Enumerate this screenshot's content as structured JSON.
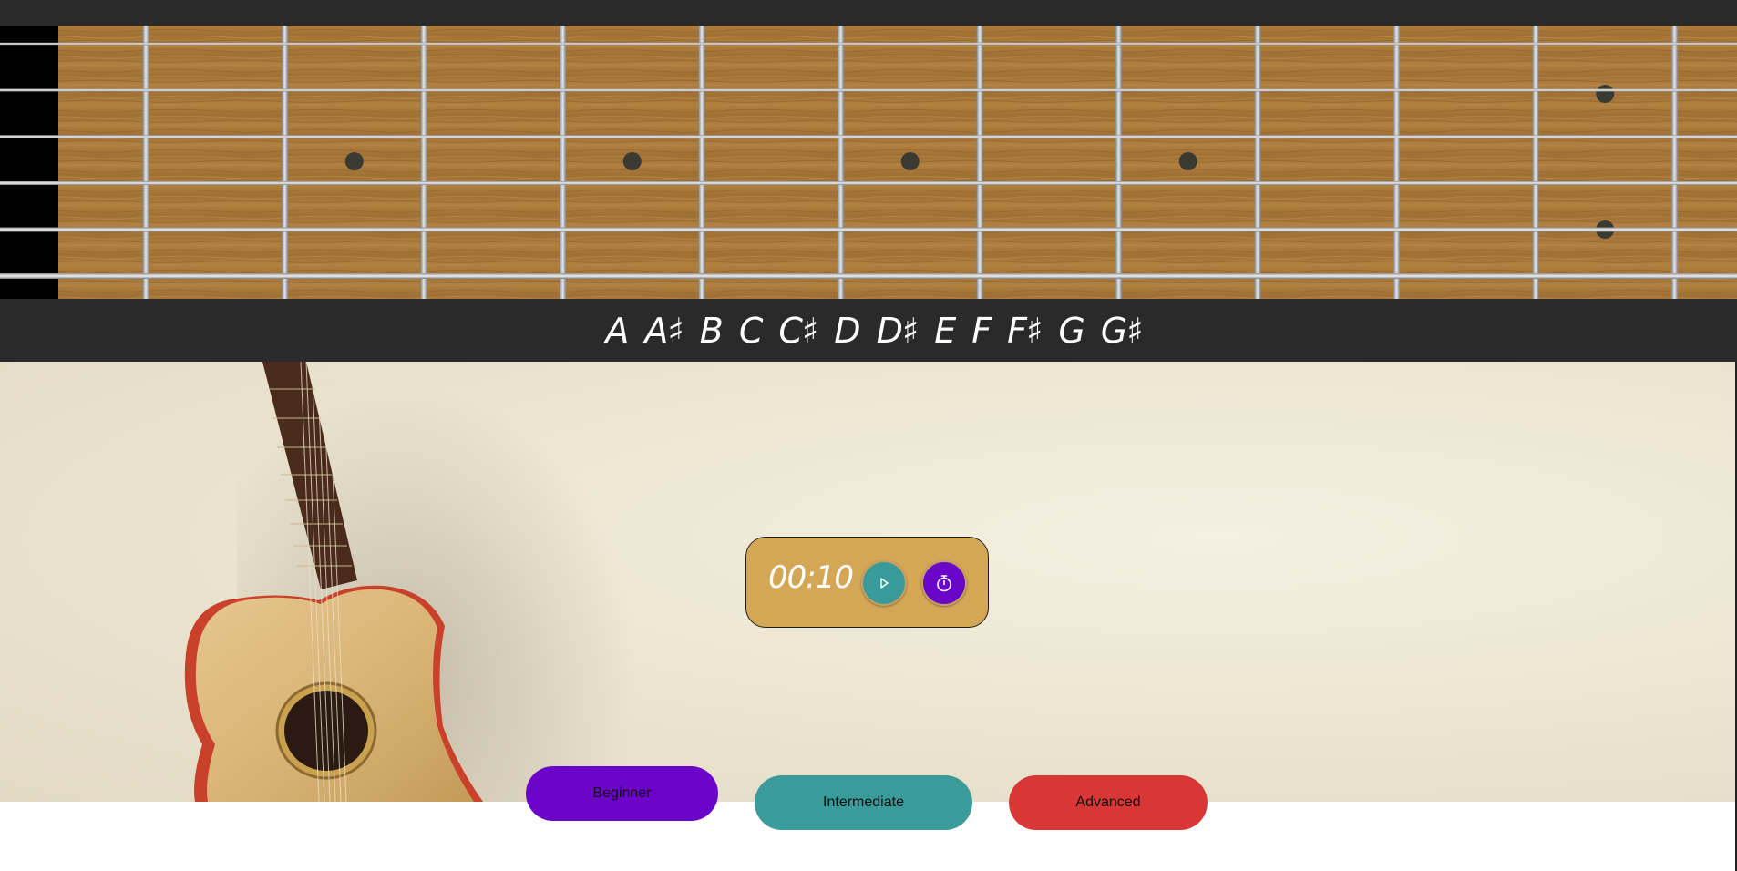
{
  "fretboard": {
    "strings": 6,
    "frets": 12,
    "marker_frets": [
      3,
      5,
      7,
      9,
      12
    ],
    "colors": {
      "wood": "#a8783a",
      "fret_wire": "#b8bcc0",
      "string": "#d6d6d6",
      "nut": "#000000",
      "marker": "#3a3a32"
    }
  },
  "notes": [
    "A",
    "A♯",
    "B",
    "C",
    "C♯",
    "D",
    "D♯",
    "E",
    "F",
    "F♯",
    "G",
    "G♯"
  ],
  "timer": {
    "display": "00:10",
    "play_icon": "play-icon",
    "stopwatch_icon": "stopwatch-icon"
  },
  "levels": {
    "beginner": "Beginner",
    "intermediate": "Intermediate",
    "advanced": "Advanced"
  },
  "colors": {
    "header": "#2a2a2a",
    "timer_panel": "#d4a757",
    "play": "#3a9a9a",
    "stopwatch": "#6a06c8",
    "beginner": "#6b05c9",
    "intermediate": "#3b9a9a",
    "advanced": "#d93636"
  }
}
